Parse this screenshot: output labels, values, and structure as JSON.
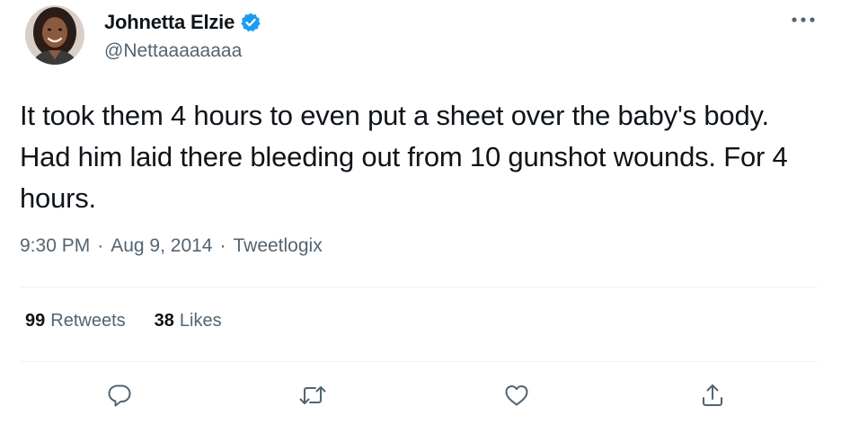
{
  "author": {
    "name": "Johnetta Elzie",
    "handle": "@Nettaaaaaaaa",
    "verified": true,
    "avatar_icon": "profile-photo"
  },
  "tweet": {
    "text": "It took them 4 hours to even put a sheet over the baby's body. Had him laid there bleeding out from 10 gunshot wounds. For 4 hours."
  },
  "meta": {
    "time": "9:30 PM",
    "separator": "·",
    "date": "Aug 9, 2014",
    "source": "Tweetlogix"
  },
  "stats": {
    "retweets_count": "99",
    "retweets_label": "Retweets",
    "likes_count": "38",
    "likes_label": "Likes"
  },
  "actions": [
    "reply-icon",
    "retweet-icon",
    "like-icon",
    "share-icon"
  ],
  "colors": {
    "text_primary": "#0f1419",
    "text_secondary": "#536471",
    "verified_blue": "#1d9bf0",
    "divider": "#eff3f4",
    "action_icon": "#536471"
  }
}
